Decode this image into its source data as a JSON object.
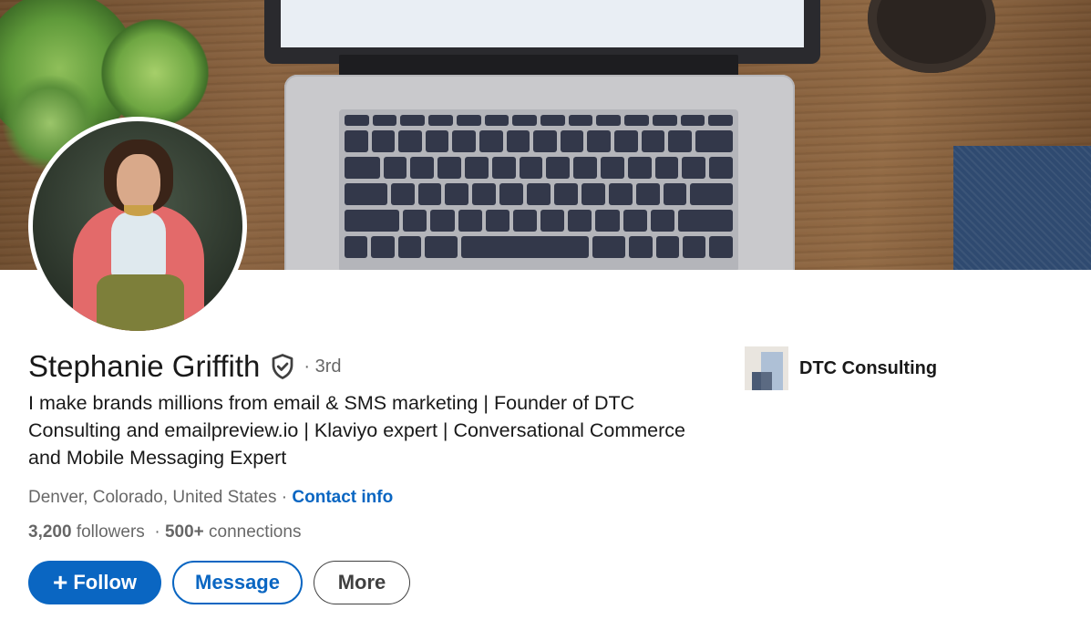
{
  "profile": {
    "name": "Stephanie Griffith",
    "degree": "· 3rd",
    "headline": "I make brands millions from email & SMS marketing | Founder of DTC Consulting and emailpreview.io | Klaviyo expert | Conversational Commerce and Mobile Messaging Expert",
    "location": "Denver, Colorado, United States",
    "separator": " · ",
    "contact_label": "Contact info",
    "followers_count": "3,200",
    "followers_label": " followers",
    "network_separator": "  · ",
    "connections_count": "500+",
    "connections_label": " connections"
  },
  "company": {
    "name": "DTC Consulting"
  },
  "actions": {
    "follow_icon": "+",
    "follow_label": "Follow",
    "message_label": "Message",
    "more_label": "More"
  },
  "icons": {
    "verified": "verified-shield-icon",
    "follow": "plus-icon"
  },
  "colors": {
    "accent": "#0a66c2",
    "text_primary": "rgba(0,0,0,0.9)",
    "text_secondary": "rgba(0,0,0,0.6)"
  }
}
